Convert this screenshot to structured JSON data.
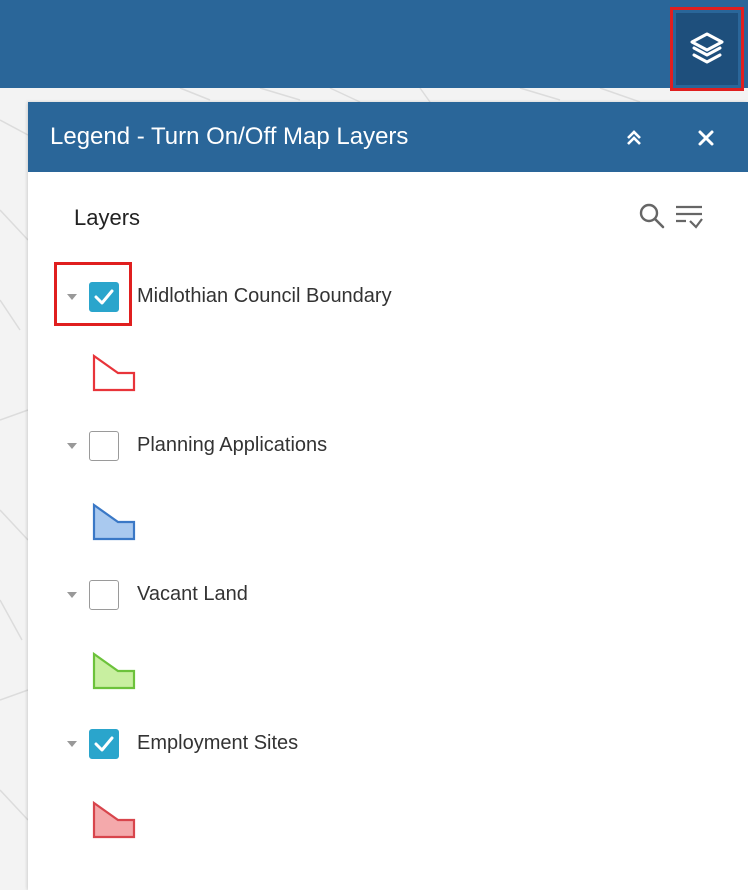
{
  "panel": {
    "title": "Legend - Turn On/Off Map Layers",
    "layers_heading": "Layers"
  },
  "icons": {
    "layers_button": "layers-stack-icon",
    "collapse": "double-chevron-up-icon",
    "close": "close-icon",
    "search": "search-icon",
    "filter": "filter-list-icon",
    "expand": "caret-down-icon",
    "check": "checkmark-icon"
  },
  "colors": {
    "header_bg": "#2a6699",
    "layers_button_bg": "#1e4f7c",
    "checkbox_checked": "#2aa5cc",
    "highlight": "#e01f1f"
  },
  "layers": [
    {
      "label": "Midlothian Council Boundary",
      "checked": true,
      "highlighted": true,
      "symbol_fill": "#ffffff",
      "symbol_stroke": "#e8343a"
    },
    {
      "label": "Planning Applications",
      "checked": false,
      "highlighted": false,
      "symbol_fill": "#a9c9ef",
      "symbol_stroke": "#3a78c6"
    },
    {
      "label": "Vacant Land",
      "checked": false,
      "highlighted": false,
      "symbol_fill": "#c8efa0",
      "symbol_stroke": "#6cc23b"
    },
    {
      "label": "Employment Sites",
      "checked": true,
      "highlighted": false,
      "symbol_fill": "#f4a9ab",
      "symbol_stroke": "#d8454c"
    }
  ]
}
